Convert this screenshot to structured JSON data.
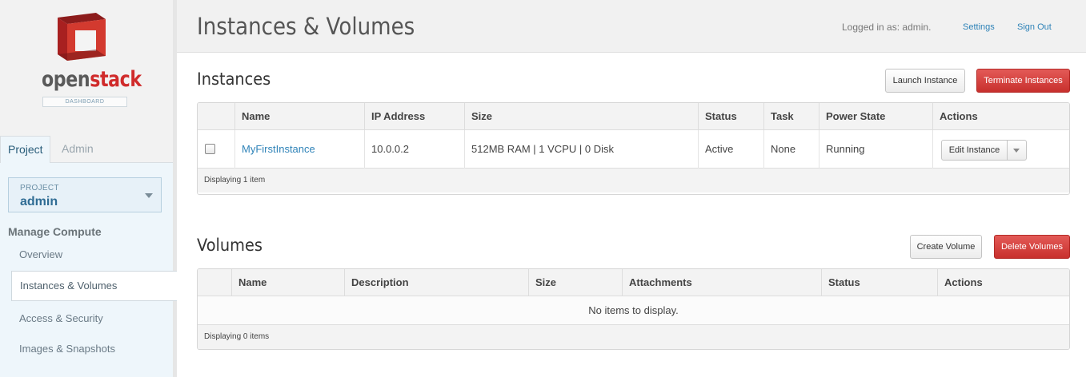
{
  "brand": {
    "logo_open": "open",
    "logo_stack": "stack",
    "logo_sub": "DASHBOARD"
  },
  "sidebar": {
    "tabs": [
      {
        "label": "Project"
      },
      {
        "label": "Admin"
      }
    ],
    "project_caption": "PROJECT",
    "project_value": "admin",
    "section_heading": "Manage Compute",
    "items": [
      {
        "label": "Overview"
      },
      {
        "label": "Instances & Volumes"
      },
      {
        "label": "Access & Security"
      },
      {
        "label": "Images & Snapshots"
      }
    ]
  },
  "header": {
    "title": "Instances & Volumes",
    "logged_in": "Logged in as: admin.",
    "settings": "Settings",
    "sign_out": "Sign Out"
  },
  "instances": {
    "title": "Instances",
    "launch_button": "Launch Instance",
    "terminate_button": "Terminate Instances",
    "columns": [
      "Name",
      "IP Address",
      "Size",
      "Status",
      "Task",
      "Power State",
      "Actions"
    ],
    "rows": [
      {
        "name": "MyFirstInstance",
        "ip": "10.0.0.2",
        "size": "512MB RAM | 1 VCPU | 0 Disk",
        "status": "Active",
        "task": "None",
        "power": "Running",
        "action": "Edit Instance"
      }
    ],
    "footer": "Displaying 1 item"
  },
  "volumes": {
    "title": "Volumes",
    "create_button": "Create Volume",
    "delete_button": "Delete Volumes",
    "columns": [
      "Name",
      "Description",
      "Size",
      "Attachments",
      "Status",
      "Actions"
    ],
    "empty": "No items to display.",
    "footer": "Displaying 0 items"
  },
  "colors": {
    "accent": "#2f83b8",
    "danger": "#c8302d",
    "brand_red": "#d02b2b"
  }
}
